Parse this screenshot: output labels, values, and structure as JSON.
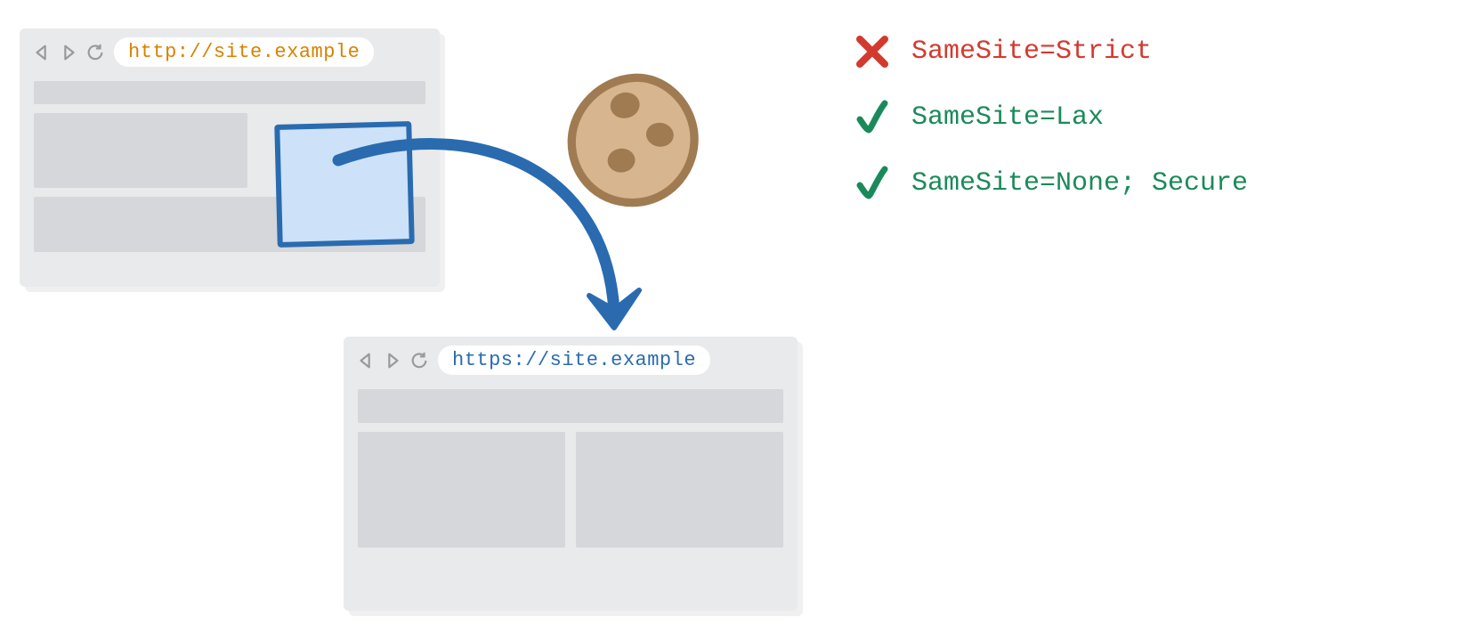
{
  "browser1": {
    "url": "http://site.example"
  },
  "browser2": {
    "url": "https://site.example"
  },
  "legend": {
    "strict": "SameSite=Strict",
    "lax": "SameSite=Lax",
    "none": "SameSite=None; Secure"
  }
}
